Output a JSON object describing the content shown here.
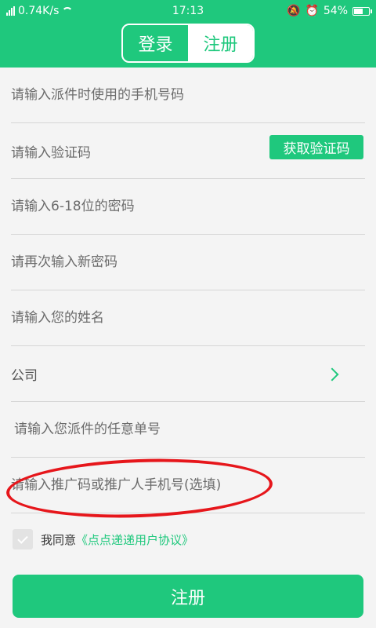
{
  "status_bar": {
    "network_speed": "0.74K/s",
    "time": "17:13",
    "battery_percent": "54%"
  },
  "header": {
    "tabs": [
      {
        "label": "登录",
        "active": false
      },
      {
        "label": "注册",
        "active": true
      }
    ]
  },
  "form": {
    "phone_placeholder": "请输入派件时使用的手机号码",
    "code_placeholder": "请输入验证码",
    "get_code_label": "获取验证码",
    "password_placeholder": "请输入6-18位的密码",
    "confirm_password_placeholder": "请再次输入新密码",
    "name_placeholder": "请输入您的姓名",
    "company_label": "公司",
    "order_placeholder": "请输入您派件的任意单号",
    "referral_placeholder": "请输入推广码或推广人手机号(选填)"
  },
  "agreement": {
    "checked": true,
    "text": "我同意",
    "link": "《点点递递用户协议》"
  },
  "submit_label": "注册",
  "colors": {
    "brand_green": "#1fc87d",
    "highlight_red": "#e6161b"
  }
}
